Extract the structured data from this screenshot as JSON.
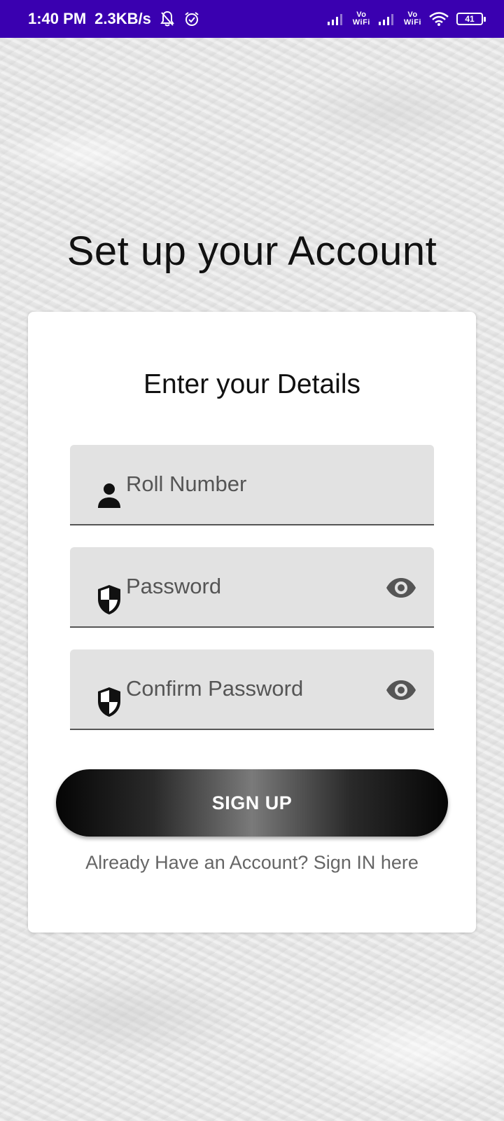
{
  "status_bar": {
    "time": "1:40 PM",
    "speed": "2.3KB/s",
    "vowifi_top": "Vo",
    "vowifi_bottom": "WiFi",
    "battery": "41",
    "icons": [
      "muted-bell-icon",
      "alarm-icon",
      "signal-icon",
      "vowifi-icon",
      "signal-icon",
      "vowifi-icon",
      "wifi-icon",
      "battery-icon"
    ]
  },
  "page": {
    "title": "Set up your Account"
  },
  "card": {
    "title": "Enter your Details",
    "fields": {
      "roll_number": {
        "placeholder": "Roll Number",
        "icon": "person-icon"
      },
      "password": {
        "placeholder": "Password",
        "icon": "shield-icon",
        "toggle_icon": "eye-icon"
      },
      "confirm_password": {
        "placeholder": "Confirm Password",
        "icon": "shield-icon",
        "toggle_icon": "eye-icon"
      }
    },
    "signup_label": "SIGN UP",
    "signin_link": "Already Have an Account? Sign IN here"
  },
  "colors": {
    "status_bar": "#3a00b0",
    "field_bg": "#e2e2e2",
    "text_dark": "#111111",
    "text_muted": "#666666"
  }
}
